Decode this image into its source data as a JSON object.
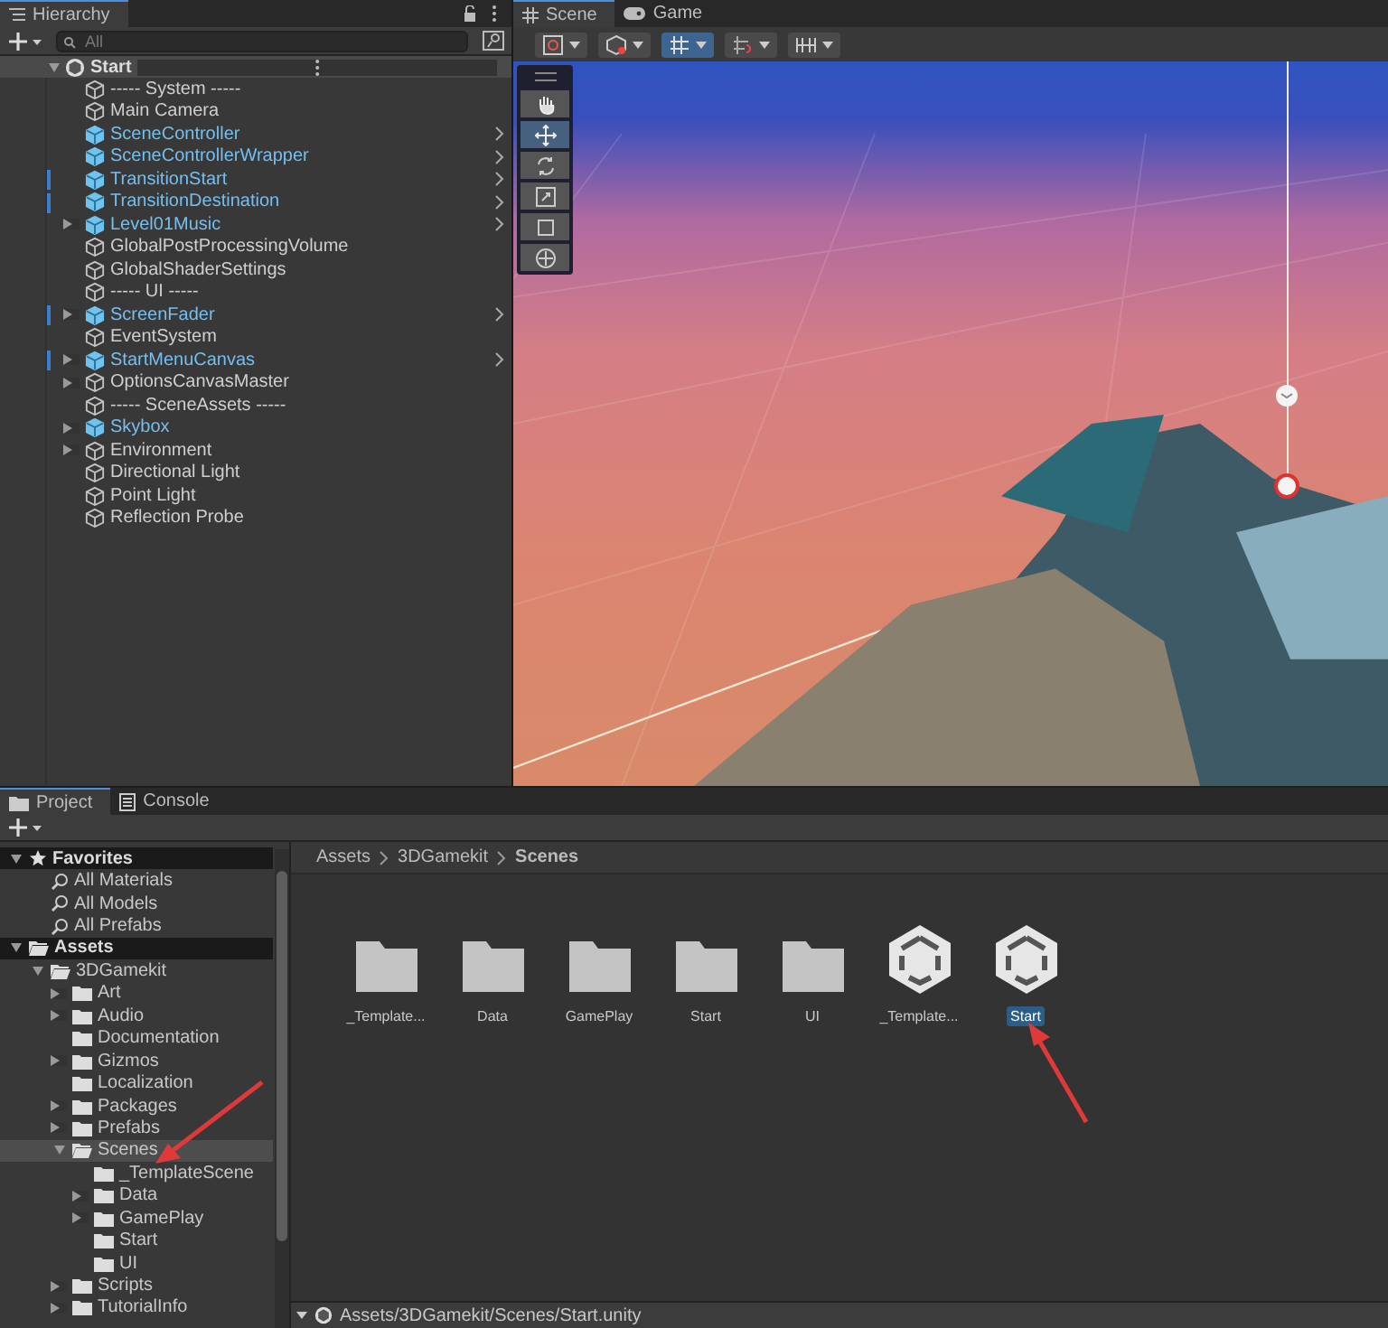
{
  "hierarchy": {
    "tab": "Hierarchy",
    "search": {
      "placeholder": "All"
    },
    "scene": {
      "label": "Start",
      "expanded": true
    },
    "items": [
      {
        "label": "----- System -----",
        "prefab": false,
        "expandable": false,
        "modified": false,
        "chevron": false
      },
      {
        "label": "Main Camera",
        "prefab": false,
        "expandable": false,
        "modified": false,
        "chevron": false
      },
      {
        "label": "SceneController",
        "prefab": true,
        "expandable": false,
        "modified": false,
        "chevron": true
      },
      {
        "label": "SceneControllerWrapper",
        "prefab": true,
        "expandable": false,
        "modified": false,
        "chevron": true
      },
      {
        "label": "TransitionStart",
        "prefab": true,
        "expandable": false,
        "modified": true,
        "chevron": true
      },
      {
        "label": "TransitionDestination",
        "prefab": true,
        "expandable": false,
        "modified": true,
        "chevron": true
      },
      {
        "label": "Level01Music",
        "prefab": true,
        "expandable": true,
        "modified": false,
        "chevron": true
      },
      {
        "label": "GlobalPostProcessingVolume",
        "prefab": false,
        "expandable": false,
        "modified": false,
        "chevron": false
      },
      {
        "label": "GlobalShaderSettings",
        "prefab": false,
        "expandable": false,
        "modified": false,
        "chevron": false
      },
      {
        "label": "----- UI -----",
        "prefab": false,
        "expandable": false,
        "modified": false,
        "chevron": false
      },
      {
        "label": "ScreenFader",
        "prefab": true,
        "expandable": true,
        "modified": true,
        "chevron": true
      },
      {
        "label": "EventSystem",
        "prefab": false,
        "expandable": false,
        "modified": false,
        "chevron": false
      },
      {
        "label": "StartMenuCanvas",
        "prefab": true,
        "expandable": true,
        "modified": true,
        "chevron": true
      },
      {
        "label": "OptionsCanvasMaster",
        "prefab": false,
        "expandable": true,
        "modified": false,
        "chevron": false
      },
      {
        "label": "----- SceneAssets -----",
        "prefab": false,
        "expandable": false,
        "modified": false,
        "chevron": false
      },
      {
        "label": "Skybox",
        "prefab": true,
        "expandable": true,
        "modified": false,
        "chevron": false
      },
      {
        "label": "Environment",
        "prefab": false,
        "expandable": true,
        "modified": false,
        "chevron": false
      },
      {
        "label": "Directional Light",
        "prefab": false,
        "expandable": false,
        "modified": false,
        "chevron": false
      },
      {
        "label": "Point Light",
        "prefab": false,
        "expandable": false,
        "modified": false,
        "chevron": false
      },
      {
        "label": "Reflection Probe",
        "prefab": false,
        "expandable": false,
        "modified": false,
        "chevron": false
      }
    ]
  },
  "scene_view": {
    "tabs": [
      {
        "label": "Scene",
        "selected": true
      },
      {
        "label": "Game",
        "selected": false
      }
    ],
    "toolbar": [
      {
        "kind": "gizmo",
        "on": false
      },
      {
        "kind": "shading",
        "on": false
      },
      {
        "kind": "grid",
        "on": true
      },
      {
        "kind": "snap",
        "on": false
      },
      {
        "kind": "increment",
        "on": false
      }
    ],
    "tools": [
      {
        "kind": "hand",
        "selected": false
      },
      {
        "kind": "move",
        "selected": true
      },
      {
        "kind": "rotate",
        "selected": false
      },
      {
        "kind": "scale",
        "selected": false
      },
      {
        "kind": "rect",
        "selected": false
      },
      {
        "kind": "transform",
        "selected": false
      }
    ]
  },
  "project": {
    "tabs": [
      {
        "label": "Project",
        "selected": true
      },
      {
        "label": "Console",
        "selected": false
      }
    ],
    "tree": [
      {
        "label": "Favorites",
        "kind": "favorites",
        "expanded": true,
        "selected": false,
        "children": [
          {
            "label": "All Materials",
            "kind": "search",
            "selected": false
          },
          {
            "label": "All Models",
            "kind": "search",
            "selected": false
          },
          {
            "label": "All Prefabs",
            "kind": "search",
            "selected": false
          }
        ]
      },
      {
        "label": "Assets",
        "kind": "folder",
        "expanded": true,
        "selected": false,
        "children": [
          {
            "label": "3DGamekit",
            "kind": "folder",
            "expanded": true,
            "selected": false,
            "children": [
              {
                "label": "Art",
                "kind": "folder",
                "expanded": false,
                "selected": false
              },
              {
                "label": "Audio",
                "kind": "folder",
                "expanded": false,
                "selected": false
              },
              {
                "label": "Documentation",
                "kind": "folder",
                "selected": false
              },
              {
                "label": "Gizmos",
                "kind": "folder",
                "expanded": false,
                "selected": false
              },
              {
                "label": "Localization",
                "kind": "folder",
                "selected": false
              },
              {
                "label": "Packages",
                "kind": "folder",
                "expanded": false,
                "selected": false
              },
              {
                "label": "Prefabs",
                "kind": "folder",
                "expanded": false,
                "selected": false
              },
              {
                "label": "Scenes",
                "kind": "folder",
                "expanded": true,
                "selected": true,
                "children": [
                  {
                    "label": "_TemplateScene",
                    "kind": "folder",
                    "selected": false
                  },
                  {
                    "label": "Data",
                    "kind": "folder",
                    "expanded": false,
                    "selected": false
                  },
                  {
                    "label": "GamePlay",
                    "kind": "folder",
                    "expanded": false,
                    "selected": false
                  },
                  {
                    "label": "Start",
                    "kind": "folder",
                    "selected": false
                  },
                  {
                    "label": "UI",
                    "kind": "folder",
                    "selected": false
                  }
                ]
              },
              {
                "label": "Scripts",
                "kind": "folder",
                "expanded": false,
                "selected": false
              },
              {
                "label": "TutorialInfo",
                "kind": "folder",
                "expanded": false,
                "selected": false
              }
            ]
          }
        ]
      }
    ],
    "breadcrumb": [
      "Assets",
      "3DGamekit",
      "Scenes"
    ],
    "assets": [
      {
        "label": "_Template...",
        "kind": "folder",
        "selected": false
      },
      {
        "label": "Data",
        "kind": "folder",
        "selected": false
      },
      {
        "label": "GamePlay",
        "kind": "folder",
        "selected": false
      },
      {
        "label": "Start",
        "kind": "folder",
        "selected": false
      },
      {
        "label": "UI",
        "kind": "folder",
        "selected": false
      },
      {
        "label": "_Template...",
        "kind": "scene",
        "selected": false
      },
      {
        "label": "Start",
        "kind": "scene",
        "selected": true
      }
    ],
    "status_path": "Assets/3DGamekit/Scenes/Start.unity"
  }
}
